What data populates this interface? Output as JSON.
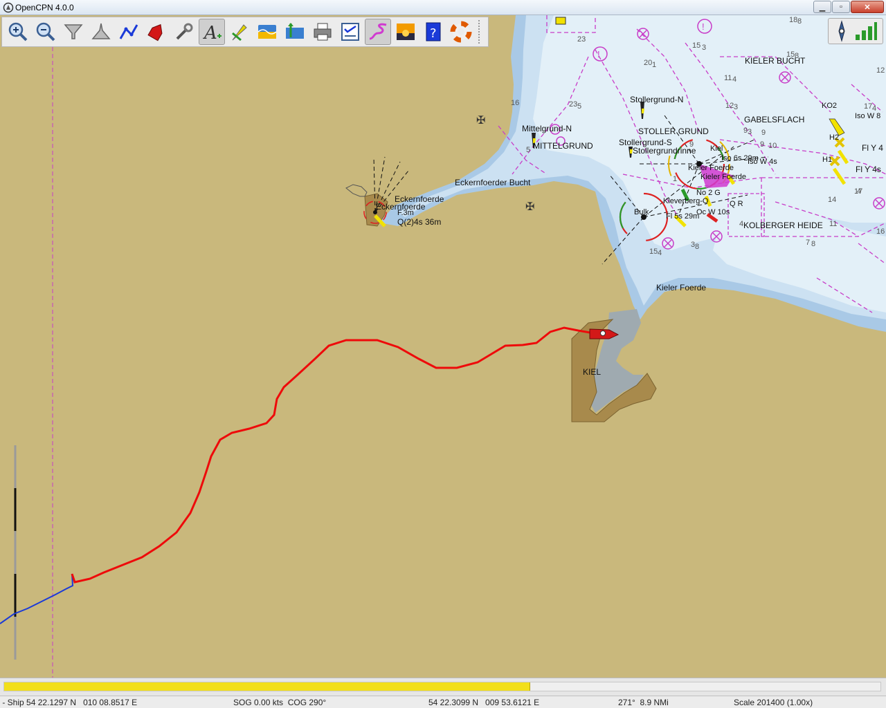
{
  "window": {
    "title": "OpenCPN 4.0.0"
  },
  "toolbar": {
    "tools": [
      {
        "name": "zoom-in-tool"
      },
      {
        "name": "zoom-out-tool"
      },
      {
        "name": "scale-in-tool"
      },
      {
        "name": "scale-out-tool"
      },
      {
        "name": "route-tool"
      },
      {
        "name": "follow-ship-tool"
      },
      {
        "name": "settings-tool"
      },
      {
        "name": "text-tool"
      },
      {
        "name": "current-tool"
      },
      {
        "name": "tides-tool"
      },
      {
        "name": "quilt-tool"
      },
      {
        "name": "print-tool"
      },
      {
        "name": "route-manager-tool"
      },
      {
        "name": "track-tool"
      },
      {
        "name": "color-scheme-tool"
      },
      {
        "name": "help-tool"
      },
      {
        "name": "mob-tool"
      }
    ]
  },
  "chart_labels": {
    "kieler_bucht": "KIELER BUCHT",
    "gabelsflach": "GABELSFLACH",
    "stollergrund_n": "Stollergrund-N",
    "stoller_grund": "STOLLER GRUND",
    "stollergrund_s": "Stollergrund-S",
    "stollergrund_rinne": "Stollergrundrinne",
    "mittelgrund_n": "Mittelgrund-N",
    "mittelgrund": "MITTELGRUND",
    "eckernfoerder_bucht": "Eckernfoerder Bucht",
    "eckernfoerde_1": "Eckernfoerde",
    "eckernfoerde_2": "Eckernfoerde",
    "eckern_light": "F.3m",
    "eckern_light2": "Q(2)4s 36m",
    "kiel_light": "Kiel",
    "kiel_light_char": "Iso 6s 29m",
    "iso_w_4s": "Iso W 4s",
    "kieler_foerde_light": "Kieler Foerde",
    "kielerfoerde_2": "Kieler Foerde",
    "bulk": "Bulk",
    "kleverberg": "Kleverberg-O",
    "bulk_char": "Fl 5s 29m",
    "no2g": "No 2 G",
    "orw": "Oc W 10s",
    "qr": "Q R",
    "kolberger_heide": "KOLBERGER HEIDE",
    "kieler_foerde": "Kieler Foerde",
    "kiel_city": "KIEL",
    "ko2": "KO2",
    "h2": "H2",
    "h1": "H1",
    "fly4": "Fl Y 4",
    "fly4s": "Fl Y 4s",
    "isow": "Iso W 8"
  },
  "depths": [
    "18",
    "8",
    "15",
    "3",
    "20",
    "1",
    "15",
    "8",
    "11",
    "4",
    "23",
    "5",
    "12",
    "3",
    "9",
    "3",
    "9",
    "9",
    "10",
    "9",
    "17",
    "4",
    "5",
    "1",
    "16",
    "4",
    "3",
    "8",
    "11",
    "7",
    "8",
    "14",
    "4",
    "12",
    "17",
    "16",
    "15",
    "4",
    "23"
  ],
  "progress": {
    "value": 0.6
  },
  "status": {
    "ship": " - Ship 54 22.1297 N   010 08.8517 E",
    "sog_cog": "SOG 0.00 kts  COG 290°",
    "cursor": "54 22.3099 N   009 53.6121 E",
    "bearing": "271°  8.9 NMi",
    "scale": "Scale 201400 (1.00x)"
  },
  "colors": {
    "land": "#c9b87c",
    "shallow": "#a9c9e6",
    "mid": "#cce1f2",
    "deep": "#e3f0f8",
    "track": "#ee0a0a",
    "track_old": "#1a3ad8",
    "restricted": "#c83cc8"
  }
}
